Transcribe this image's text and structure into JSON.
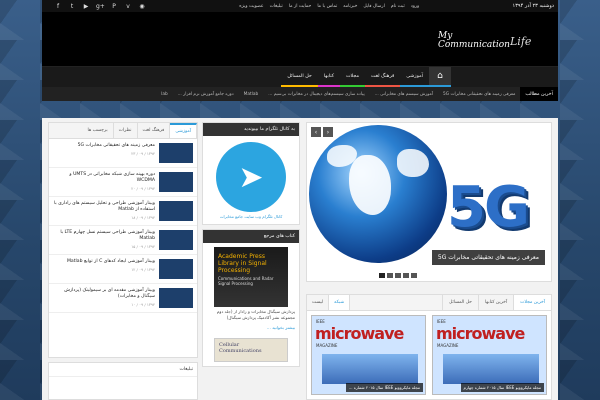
{
  "topbar": {
    "date": "دوشنبه ۲۳ آذر ۱۳۹۴",
    "menu": [
      "ورود",
      "ثبت نام",
      "ارسال فایل",
      "خبرنامه",
      "تماس با ما",
      "حمایت از ما",
      "تبلیغات",
      "عضویت ویژه"
    ],
    "social": [
      "facebook-icon",
      "twitter-icon",
      "youtube-icon",
      "googleplus-icon",
      "pinterest-icon",
      "vimeo-icon",
      "rss-icon"
    ]
  },
  "logo": {
    "line1": "My",
    "line2": "Communication",
    "line3": "Life"
  },
  "nav": {
    "home_glyph": "⌂",
    "items": [
      "آموزشی",
      "فرهنگ لغت",
      "مجلات",
      "کتابها",
      "حل المسائل"
    ]
  },
  "ticker": {
    "label": "آخرین مطالب",
    "items": [
      "معرفی زمینه های تحقیقاتی مخابرات 5G",
      "آموزش سیستم های مخابراتی ...",
      "پیاده سازی سیستم‌های دیجیتال در مخابرات بی‌سیم ...",
      "Matlab",
      "دوره جامع آموزش نرم افزار ...",
      "lab"
    ]
  },
  "slider": {
    "caption": "معرفی زمینه های تحقیقاتی مخابرات 5G",
    "big_text": "5G",
    "prev": "‹",
    "next": "›"
  },
  "telegram": {
    "title": "به کانال تلگرام ما بپیوندید",
    "glyph": "➤",
    "text": "کانال تلگرام وب سایت جامع مخابرات"
  },
  "books": {
    "title": "کتاب های مرجع",
    "book1_title": "Academic Press Library in Signal Processing",
    "book1_sub": "Communications and Radar Signal Processing",
    "book1_text": "پردازش سیگنال مخابرات و رادار از (جلد دوم مجموعه نشر آکادمیک پردازش سیگنال)",
    "book1_link": "بیشتر بخوانید ...",
    "book2_title": "Cellular Communications"
  },
  "left_tabs": {
    "tabs": [
      "آموزشی",
      "فرهنگ لغت",
      "نظرات",
      "برچسب ها"
    ],
    "items": [
      {
        "title": "معرفی زمینه های تحقیقاتی مخابرات 5G",
        "meta": "۱۳۹۴ / ۰۹ / ۲۳"
      },
      {
        "title": "دوره بهینه سازی شبکه مخابراتی در UMTS و WCDMA",
        "meta": "۱۳۹۴ / ۰۹ / ۲۰"
      },
      {
        "title": "وبینار آموزشی طراحی و تحلیل سیستم های راداری با استفاده از Matlab",
        "meta": "۱۳۹۴ / ۰۹ / ۱۸"
      },
      {
        "title": "وبینار آموزشی طراحی سیستم نسل چهارم LTE با Matlab",
        "meta": "۱۳۹۴ / ۰۹ / ۱۵"
      },
      {
        "title": "وبینار آموزشی ایجاد کدهای C از توابع Matlab",
        "meta": "۱۳۹۴ / ۰۹ / ۱۲"
      },
      {
        "title": "وبینار آموزشی مقدمه ای بر سیمولینک (پردازش سیگنال و مخابرات)",
        "meta": "۱۳۹۴ / ۰۹ / ۱۰"
      }
    ]
  },
  "ads": {
    "title": "تبلیغات"
  },
  "bottom_tabs": {
    "tabs": [
      "آخرین مجلات",
      "آخرین کتابها",
      "حل المسائل"
    ],
    "view": [
      "شبکه",
      "لیست"
    ],
    "mags": [
      {
        "ieee": "IEEE",
        "title": "microwave",
        "sub": "MAGAZINE",
        "caption": "مجله مایکروویو IEEE سال ۲۰۱۵ شماره چهارم"
      },
      {
        "ieee": "IEEE",
        "title": "microwave",
        "sub": "MAGAZINE",
        "caption": "مجله مایکروویو IEEE سال ۲۰۱۵ شماره ..."
      }
    ]
  }
}
